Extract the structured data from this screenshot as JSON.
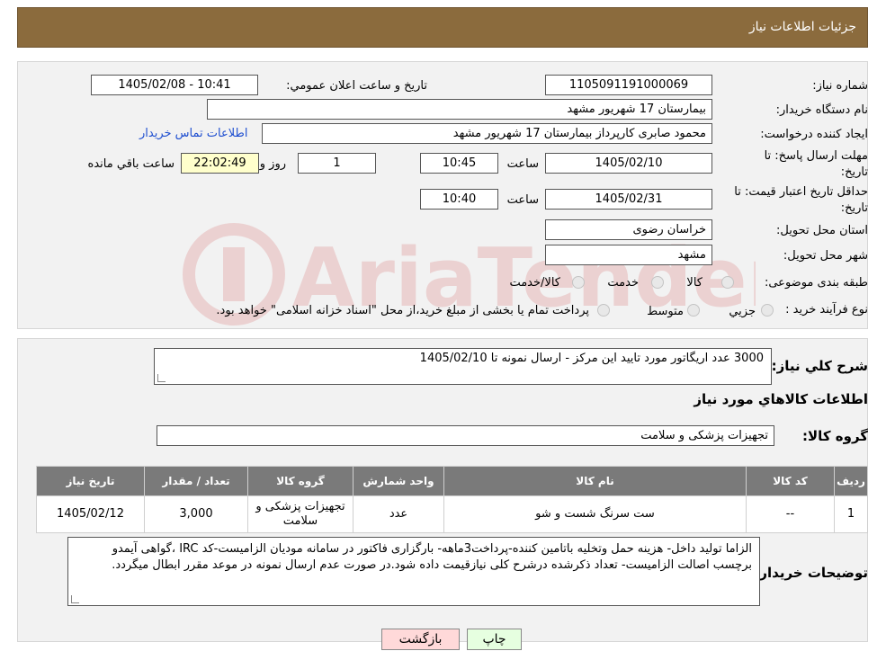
{
  "header": {
    "title": "جزئیات اطلاعات نیاز"
  },
  "form": {
    "need_number_label": "شماره نیاز:",
    "need_number": "1105091191000069",
    "announce_label": "تاريخ و ساعت اعلان عمومي:",
    "announce_value": "1405/02/08 - 10:41",
    "buyer_org_label": "نام دستگاه خریدار:",
    "buyer_org": "بیمارستان 17 شهریور مشهد",
    "creator_label": "ایجاد کننده درخواست:",
    "creator": "محمود صابری کارپرداز بیمارستان 17 شهریور مشهد",
    "contact_link": "اطلاعات تماس خریدار",
    "deadline_label_1": "مهلت ارسال پاسخ: تا",
    "deadline_label_2": "تاریخ:",
    "deadline_date": "1405/02/10",
    "time_label": "ساعت",
    "deadline_time": "10:45",
    "days_value": "1",
    "days_label": "روز و",
    "remaining_time": "22:02:49",
    "remaining_label": "ساعت باقي مانده",
    "validity_label_1": "حداقل تاریخ اعتبار قیمت: تا",
    "validity_label_2": "تاریخ:",
    "validity_date": "1405/02/31",
    "validity_time": "10:40",
    "province_label": "استان محل تحویل:",
    "province": "خراسان رضوی",
    "city_label": "شهر محل تحویل:",
    "city": "مشهد",
    "category_label": "طبقه بندی موضوعی:",
    "category_options": [
      "کالا",
      "خدمت",
      "کالا/خدمت"
    ],
    "process_label": "نوع فرآیند خرید :",
    "process_options": [
      "جزیي",
      "متوسط"
    ],
    "process_note": "پرداخت تمام یا بخشی از مبلغ خرید،از محل \"اسناد خزانه اسلامی\" خواهد بود."
  },
  "summary": {
    "label": "شرح كلي نياز:",
    "text": "3000 عدد اریگاتور مورد تایید این مرکز - ارسال نمونه تا 1405/02/10",
    "goods_info_title": "اطلاعات كالاهاي مورد نياز",
    "group_label": "گروه کالا:",
    "group_value": "تجهیزات پزشکی و سلامت"
  },
  "table": {
    "headers": [
      "رديف",
      "کد کالا",
      "نام کالا",
      "واحد شمارش",
      "گروه کالا",
      "تعداد / مقدار",
      "تاریخ نیاز"
    ],
    "rows": [
      [
        "1",
        "--",
        "ست سرنگ شست و شو",
        "عدد",
        "تجهیزات پزشکی و سلامت",
        "3,000",
        "1405/02/12"
      ]
    ]
  },
  "buyer_notes": {
    "label": "توضیحات خریدار:",
    "text": "الزاما تولید داخل- هزینه حمل وتخلیه باتامین کننده-پرداخت3ماهه- بارگزاری فاکتور در سامانه مودیان الزامیست-کد IRC ،گواهی آیمدو برچسب اصالت الزامیست- تعداد ذکرشده درشرح کلی نیازقیمت داده شود.در صورت عدم ارسال نمونه در موعد مقرر ابطال میگردد."
  },
  "buttons": {
    "print": "چاپ",
    "back": "بازگشت"
  },
  "watermark": {
    "text": "AriaTender.neT"
  },
  "colors": {
    "header_bg": "#8b6b3d",
    "table_header_bg": "#7a7a7a",
    "back_button_bg": "#ffd9d9",
    "print_button_bg": "#e6ffe0"
  }
}
